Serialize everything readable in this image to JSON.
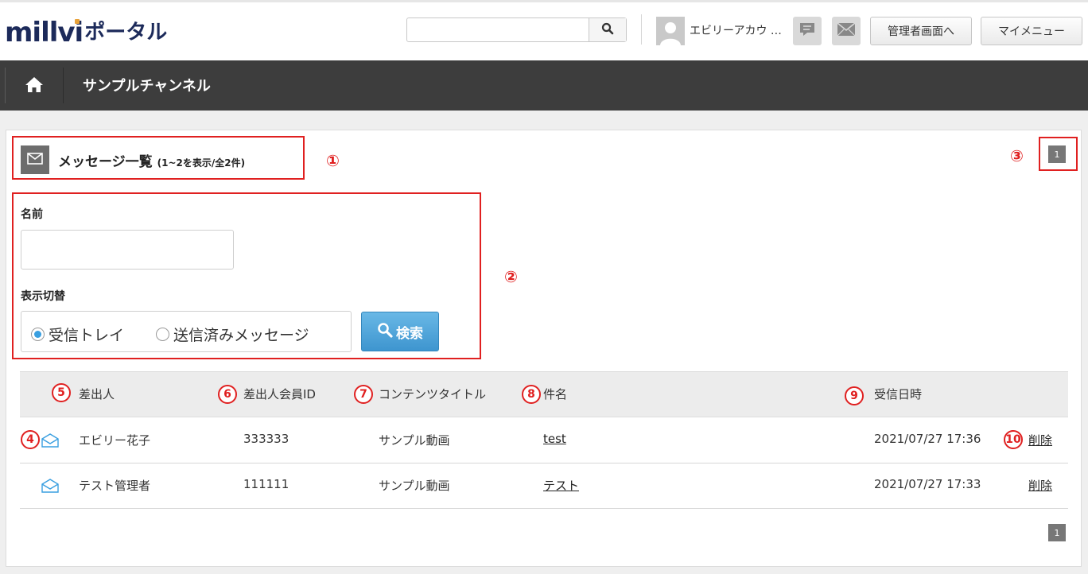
{
  "header": {
    "logo_main": "millvi",
    "logo_sub": "ポータル",
    "search_placeholder": "",
    "username": "エビリーアカウ …",
    "admin_button": "管理者画面へ",
    "mymenu_button": "マイメニュー"
  },
  "nav": {
    "channel_title": "サンプルチャンネル"
  },
  "panel": {
    "title": "メッセージ一覧",
    "count_text": "(1~2を表示/全2件)",
    "page_number": "1",
    "name_label": "名前",
    "name_value": "",
    "display_label": "表示切替",
    "radio_inbox": "受信トレイ",
    "radio_sent": "送信済みメッセージ",
    "selected": "inbox",
    "search_button": "検索"
  },
  "table": {
    "headers": {
      "sender": "差出人",
      "sender_id": "差出人会員ID",
      "content_title": "コンテンツタイトル",
      "subject": "件名",
      "received_at": "受信日時"
    },
    "rows": [
      {
        "sender": "エビリー花子",
        "sender_id": "333333",
        "content_title": "サンプル動画",
        "subject": "test",
        "received_at": "2021/07/27 17:36",
        "action": "削除"
      },
      {
        "sender": "テスト管理者",
        "sender_id": "111111",
        "content_title": "サンプル動画",
        "subject": "テスト",
        "received_at": "2021/07/27 17:33",
        "action": "削除"
      }
    ]
  },
  "annotations": [
    "①",
    "②",
    "③",
    "4",
    "5",
    "6",
    "7",
    "8",
    "9",
    "10"
  ],
  "colors": {
    "accent_red": "#e02020",
    "nav_bg": "#3d3d3d",
    "button_blue": "#3e95cf",
    "radio_on": "#3a9fe0"
  }
}
